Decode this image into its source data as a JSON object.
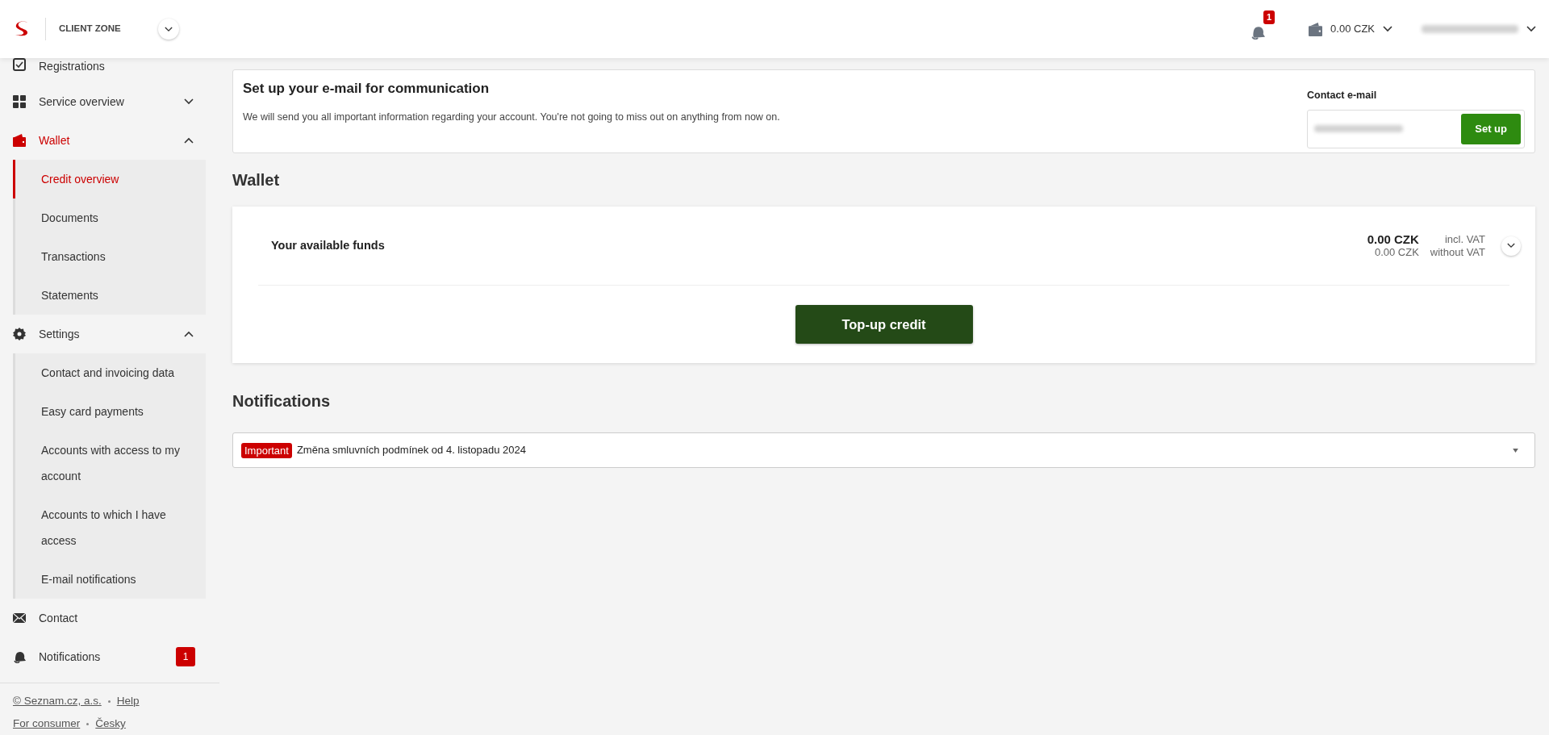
{
  "header": {
    "title": "CLIENT ZONE",
    "notification_count": "1",
    "balance": "0.00 CZK"
  },
  "sidebar": {
    "items": [
      {
        "kind": "registrations",
        "label": "Registrations",
        "selected": false
      },
      {
        "kind": "services",
        "label": "Service overview",
        "selected": false,
        "expanded": false
      },
      {
        "kind": "wallet",
        "label": "Wallet",
        "selected": true,
        "expanded": true,
        "children": [
          {
            "label": "Credit overview",
            "selected": true
          },
          {
            "label": "Documents",
            "selected": false
          },
          {
            "label": "Transactions",
            "selected": false
          },
          {
            "label": "Statements",
            "selected": false
          }
        ]
      },
      {
        "kind": "settings",
        "label": "Settings",
        "selected": false,
        "expanded": true,
        "children": [
          {
            "label": "Contact and invoicing data",
            "selected": false
          },
          {
            "label": "Easy card payments",
            "selected": false
          },
          {
            "label": "Accounts with access to my account",
            "selected": false
          },
          {
            "label": "Accounts to which I have access",
            "selected": false
          },
          {
            "label": "E-mail notifications",
            "selected": false
          }
        ]
      },
      {
        "kind": "contact",
        "label": "Contact",
        "selected": false
      },
      {
        "kind": "notifications",
        "label": "Notifications",
        "selected": false,
        "badge": "1"
      }
    ],
    "footer": [
      [
        "© Seznam.cz, a.s.",
        "Help"
      ],
      [
        "For consumer",
        "Česky"
      ]
    ]
  },
  "email_card": {
    "title": "Set up your e-mail for communication",
    "text": "We will send you all important information regarding your account. You're not going to miss out on anything from now on.",
    "field_label": "Contact e-mail",
    "button": "Set up"
  },
  "wallet": {
    "heading": "Wallet",
    "funds_label": "Your available funds",
    "amount_vat": "0.00 CZK",
    "vat_label": "incl. VAT",
    "amount_novat": "0.00 CZK",
    "novat_label": "without VAT",
    "button": "Top-up credit"
  },
  "notifications": {
    "heading": "Notifications",
    "items": [
      {
        "tag": "Important",
        "text": "Změna smluvních podmínek od 4. listopadu 2024"
      }
    ]
  }
}
